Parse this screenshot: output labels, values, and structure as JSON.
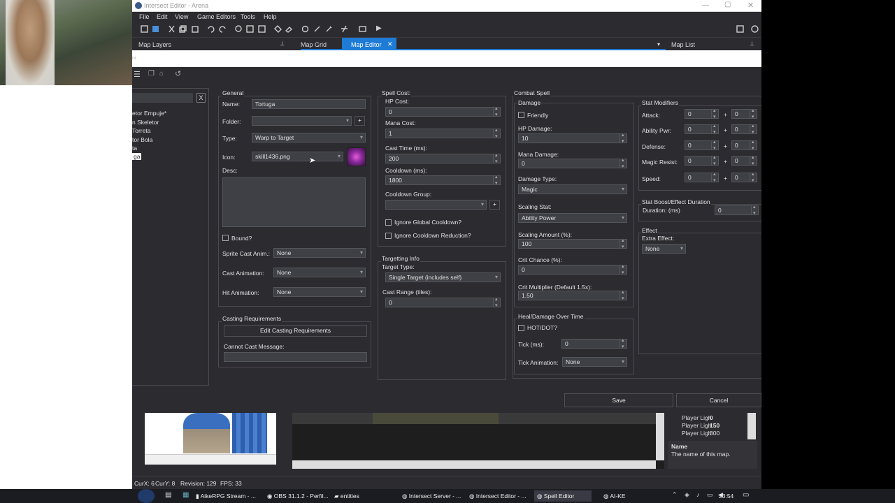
{
  "window": {
    "title": "Intersect Editor - Arena"
  },
  "menu": [
    "File",
    "Edit",
    "View",
    "Game Editors",
    "Tools",
    "Help"
  ],
  "docks": {
    "left_tab": "Map Layers",
    "tabs": [
      "Map Grid",
      "Map Editor"
    ],
    "right_tab": "Map List"
  },
  "list": {
    "filter_clear": "X",
    "items": [
      "etor Empuje*",
      "n Skeletor",
      "Torreta",
      "tor Bola",
      "ta",
      "ga"
    ]
  },
  "general": {
    "title": "General",
    "name_label": "Name:",
    "name_value": "Tortuga",
    "folder_label": "Folder:",
    "folder_value": "",
    "add": "+",
    "type_label": "Type:",
    "type_value": "Warp to Target",
    "icon_label": "Icon:",
    "icon_value": "skill1436.png",
    "desc_label": "Desc:",
    "bound_label": "Bound?",
    "sprite_anim_label": "Sprite Cast Anim.:",
    "sprite_anim_value": "None",
    "cast_anim_label": "Cast Animation:",
    "cast_anim_value": "None",
    "hit_anim_label": "Hit Animation:",
    "hit_anim_value": "None"
  },
  "casting": {
    "title": "Casting Requirements",
    "edit_button": "Edit Casting Requirements",
    "cannot_cast_label": "Cannot Cast Message:",
    "cannot_cast_value": ""
  },
  "spell_cost": {
    "title": "Spell Cost:",
    "hp_label": "HP Cost:",
    "hp_value": "0",
    "mana_label": "Mana Cost:",
    "mana_value": "1",
    "cast_time_label": "Cast Time (ms):",
    "cast_time_value": "200",
    "cooldown_label": "Cooldown (ms):",
    "cooldown_value": "1800",
    "cooldown_group_label": "Cooldown Group:",
    "cooldown_group_value": "",
    "add": "+",
    "ignore_global": "Ignore Global Cooldown?",
    "ignore_reduction": "Ignore Cooldown Reduction?"
  },
  "targeting": {
    "title": "Targetting Info",
    "type_label": "Target Type:",
    "type_value": "Single Target (includes self)",
    "range_label": "Cast Range (tiles):",
    "range_value": "0"
  },
  "combat": {
    "title": "Combat Spell",
    "damage_title": "Damage",
    "friendly": "Friendly",
    "hp_damage_label": "HP Damage:",
    "hp_damage_value": "10",
    "mana_damage_label": "Mana Damage:",
    "mana_damage_value": "0",
    "damage_type_label": "Damage Type:",
    "damage_type_value": "Magic",
    "scaling_stat_label": "Scaling Stat:",
    "scaling_stat_value": "Ability Power",
    "scaling_amount_label": "Scaling Amount (%):",
    "scaling_amount_value": "100",
    "crit_chance_label": "Crit Chance (%):",
    "crit_chance_value": "0",
    "crit_mult_label": "Crit Multiplier (Default 1.5x):",
    "crit_mult_value": "1.50"
  },
  "hot": {
    "title": "Heal/Damage Over Time",
    "hotdot": "HOT/DOT?",
    "tick_label": "Tick (ms):",
    "tick_value": "0",
    "tick_anim_label": "Tick Animation:",
    "tick_anim_value": "None"
  },
  "stats": {
    "title": "Stat Modifiers",
    "rows": [
      {
        "label": "Attack:",
        "v1": "0",
        "v2": "0"
      },
      {
        "label": "Ability Pwr:",
        "v1": "0",
        "v2": "0"
      },
      {
        "label": "Defense:",
        "v1": "0",
        "v2": "0"
      },
      {
        "label": "Magic Resist:",
        "v1": "0",
        "v2": "0"
      },
      {
        "label": "Speed:",
        "v1": "0",
        "v2": "0"
      }
    ],
    "plus": "+",
    "boost_title": "Stat Boost/Effect Duration",
    "duration_label": "Duration: (ms)",
    "duration_value": "0"
  },
  "effect": {
    "title": "Effect",
    "extra_label": "Extra Effect:",
    "extra_value": "None"
  },
  "actions": {
    "save": "Save",
    "cancel": "Cancel"
  },
  "map_list": {
    "rows": [
      {
        "k": "Player Ligh",
        "v": "0"
      },
      {
        "k": "Player Ligh",
        "v": "150"
      },
      {
        "k": "Player Ligh",
        "v": "300"
      }
    ],
    "prop_name": "Name",
    "prop_desc": "The name of this map."
  },
  "status": {
    "cur_x": "CurX: 6",
    "cur_y": "CurY: 8",
    "revision": "Revision: 129",
    "fps": "FPS: 33"
  },
  "taskbar": {
    "items": [
      "AikeRPG Stream - ...",
      "OBS 31.1.2 - Perfil...",
      "entities",
      "Intersect Server - ...",
      "Intersect Editor - ...",
      "Spell Editor",
      "AI-KE"
    ],
    "clock": "23:54"
  },
  "colors": {
    "accent": "#1e7bd6",
    "panel": "#2b2b30",
    "input": "#3f3f46"
  }
}
